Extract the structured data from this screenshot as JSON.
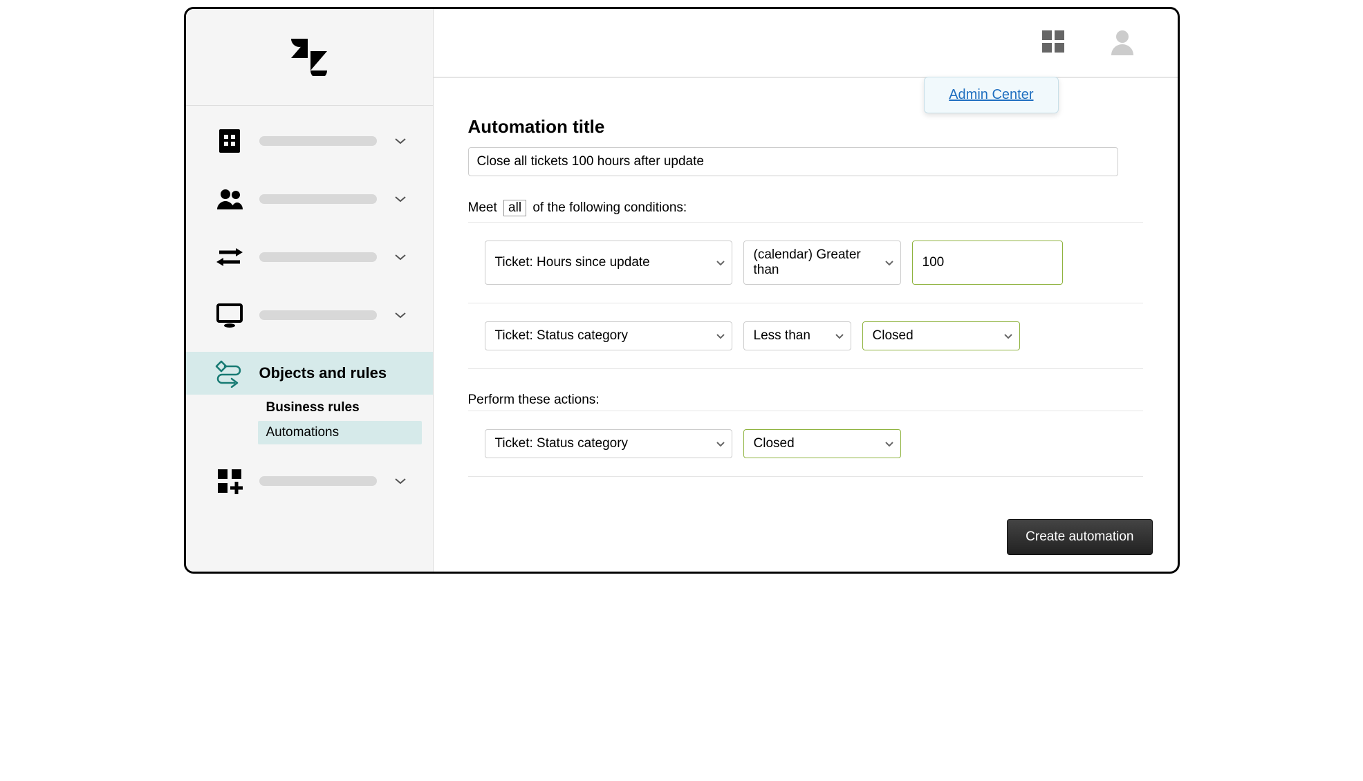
{
  "sidebar": {
    "items": [
      {
        "icon": "building",
        "label": ""
      },
      {
        "icon": "people",
        "label": ""
      },
      {
        "icon": "arrows",
        "label": ""
      },
      {
        "icon": "monitor",
        "label": ""
      },
      {
        "icon": "flow",
        "label": "Objects and rules",
        "active": true
      },
      {
        "icon": "apps-add",
        "label": ""
      }
    ],
    "subnav": {
      "heading": "Business rules",
      "item": "Automations"
    }
  },
  "header": {
    "tooltip": "Admin Center"
  },
  "form": {
    "title_label": "Automation title",
    "title_value": "Close all tickets 100 hours after update",
    "meet_prefix": "Meet",
    "meet_mode": "all",
    "meet_suffix": "of the following conditions:",
    "conditions": [
      {
        "field": "Ticket: Hours since update",
        "operator": "(calendar) Greater than",
        "value": "100",
        "value_type": "input"
      },
      {
        "field": "Ticket: Status category",
        "operator": "Less than",
        "value": "Closed",
        "value_type": "select"
      }
    ],
    "actions_label": "Perform these actions:",
    "actions": [
      {
        "field": "Ticket: Status category",
        "value": "Closed"
      }
    ],
    "submit_label": "Create automation"
  }
}
